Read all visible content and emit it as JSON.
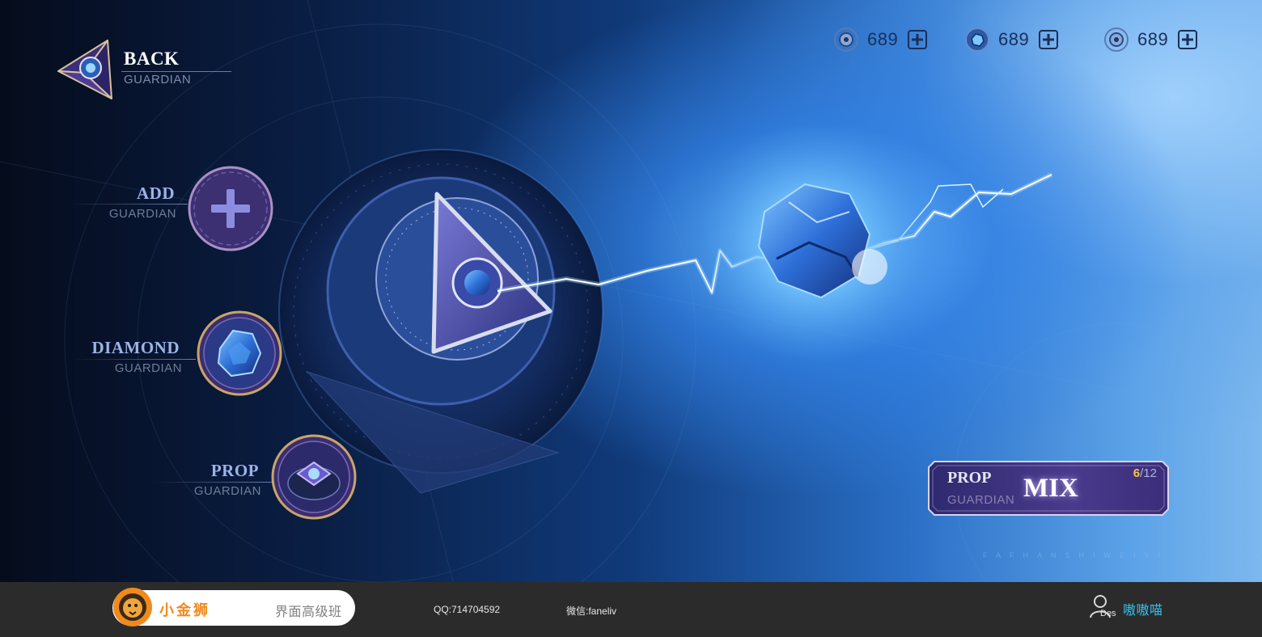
{
  "back": {
    "title": "BACK",
    "subtitle": "GUARDIAN"
  },
  "menu": [
    {
      "title": "ADD",
      "subtitle": "GUARDIAN"
    },
    {
      "title": "DIAMOND",
      "subtitle": "GUARDIAN"
    },
    {
      "title": "PROP",
      "subtitle": "GUARDIAN"
    }
  ],
  "currencies": [
    {
      "icon": "rune-coin-icon",
      "value": "689"
    },
    {
      "icon": "blue-gem-icon",
      "value": "689"
    },
    {
      "icon": "rune-coin-icon",
      "value": "689"
    }
  ],
  "mix": {
    "prop_label": "PROP",
    "sub_label": "GUARDIAN",
    "action_label": "MIX",
    "count_current": "6",
    "count_total": "/12"
  },
  "watermark": "FAFHANSHIWEIYI",
  "footer": {
    "brand": "小金狮",
    "course": "界面高级班",
    "qq": "QQ:714704592",
    "wechat": "微信:faneliv",
    "user_tag": "Des",
    "user_name": "嗷嗷喵"
  },
  "colors": {
    "accent_purple": "#4a3a8c",
    "gold": "#c9a56a",
    "user_name": "#35c3ef",
    "brand_orange": "#ef8a1f"
  }
}
